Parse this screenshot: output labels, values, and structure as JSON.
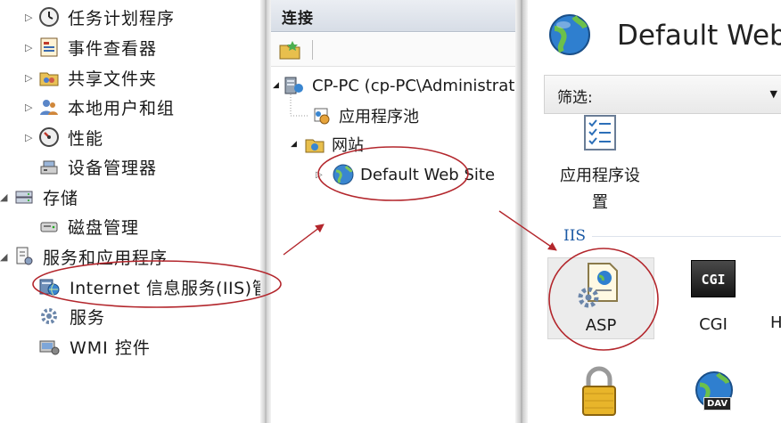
{
  "left_tree": {
    "items": [
      {
        "label": "任务计划程序",
        "expander": "▷",
        "icon": "clock-icon"
      },
      {
        "label": "事件查看器",
        "expander": "▷",
        "icon": "event-viewer-icon"
      },
      {
        "label": "共享文件夹",
        "expander": "▷",
        "icon": "shared-folder-icon"
      },
      {
        "label": "本地用户和组",
        "expander": "▷",
        "icon": "users-icon"
      },
      {
        "label": "性能",
        "expander": "▷",
        "icon": "performance-icon"
      },
      {
        "label": "设备管理器",
        "expander": "",
        "icon": "device-manager-icon"
      },
      {
        "label": "存储",
        "expander": "◢",
        "icon": "storage-icon"
      },
      {
        "label": "磁盘管理",
        "expander": "",
        "icon": "disk-icon"
      },
      {
        "label": "服务和应用程序",
        "expander": "◢",
        "icon": "services-apps-icon"
      },
      {
        "label": "Internet 信息服务(IIS)管理器",
        "expander": "",
        "icon": "iis-icon"
      },
      {
        "label": "服务",
        "expander": "",
        "icon": "gear-icon"
      },
      {
        "label": "WMI 控件",
        "expander": "",
        "icon": "wmi-icon"
      }
    ]
  },
  "connections": {
    "title": "连接",
    "tree": [
      {
        "label": "CP-PC (cp-PC\\Administrator)",
        "icon": "server-icon",
        "expander": "◢"
      },
      {
        "label": "应用程序池",
        "icon": "app-pool-icon",
        "expander": ""
      },
      {
        "label": "网站",
        "icon": "sites-folder-icon",
        "expander": "◢"
      },
      {
        "label": "Default Web Site",
        "icon": "globe-icon",
        "expander": "▷"
      }
    ]
  },
  "feature_view": {
    "title": "Default Web Site 主页",
    "filter_label": "筛选:",
    "filter_arrow": "▼",
    "group_label": "IIS",
    "features": [
      {
        "label": "应用程序设置",
        "icon": "app-settings-icon"
      },
      {
        "label": "ASP",
        "icon": "asp-icon"
      },
      {
        "label": "CGI",
        "icon": "cgi-icon",
        "badge": "CGI"
      },
      {
        "label": "H",
        "icon": "handler-icon"
      },
      {
        "label": "",
        "icon": "lock-icon"
      },
      {
        "label": "",
        "icon": "webdav-icon",
        "badge": "DAV"
      }
    ]
  },
  "colors": {
    "annotation": "#b3262c",
    "header_gradient_top": "#ebeef3",
    "header_gradient_bottom": "#d7dde6",
    "group_label": "#1c5aa5",
    "selected_feature_bg": "#ececec"
  }
}
